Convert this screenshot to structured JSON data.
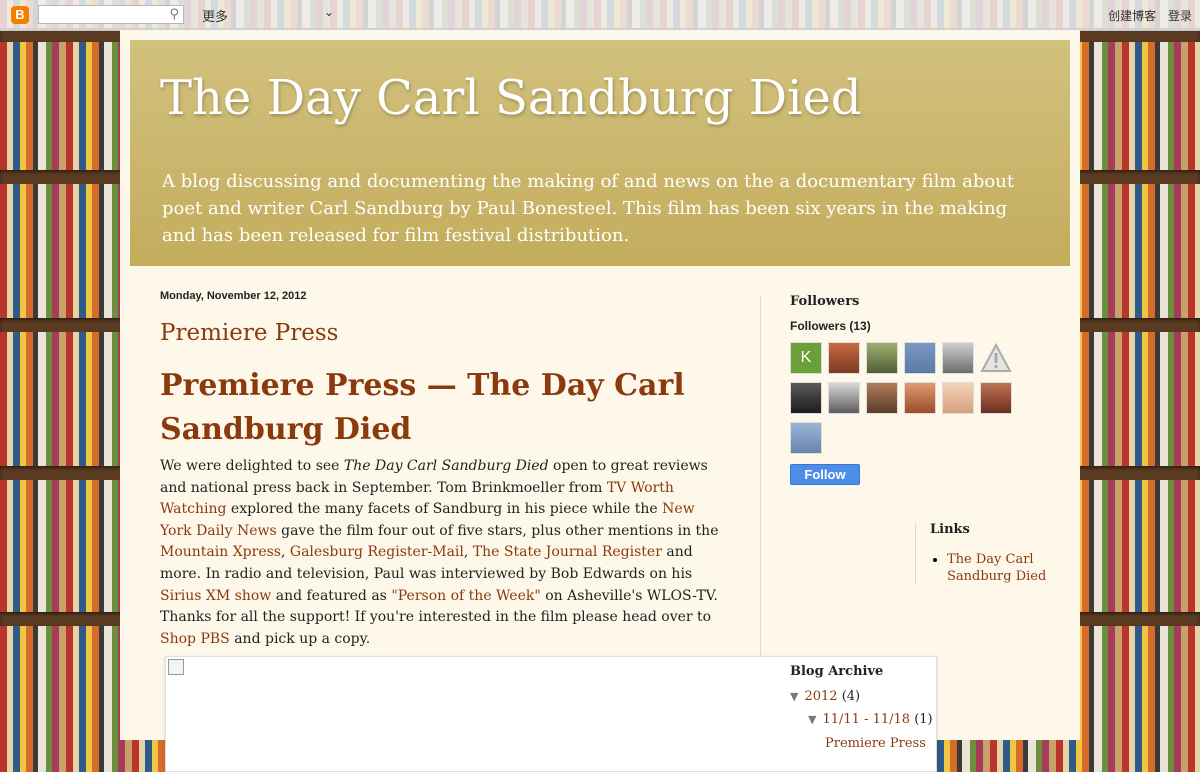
{
  "navbar": {
    "logo": "B",
    "search_placeholder": "",
    "more": "更多",
    "create_blog": "创建博客",
    "login": "登录"
  },
  "header": {
    "title": "The Day Carl Sandburg Died",
    "description": "A blog discussing and documenting the making of and news on the a documentary film about poet and writer Carl Sandburg by Paul Bonesteel. This film has been six years in the making and has been released for film festival distribution."
  },
  "post": {
    "date": "Monday, November 12, 2012",
    "title": "Premiere Press",
    "heading": "Premiere Press — The Day Carl Sandburg Died",
    "body": {
      "t1": "We were delighted to see ",
      "film": "The Day Carl Sandburg Died",
      "t2": " open to great reviews and national press back in September. Tom Brinkmoeller from ",
      "l1": "TV Worth Watching",
      "t3": " explored the many facets of Sandburg in his piece while the ",
      "l2": "New York Daily News",
      "t4": " gave the film four out of five stars, plus other mentions in the ",
      "l3": "Mountain Xpress",
      "t5": ", ",
      "l4": "Galesburg Register-Mail",
      "t6": ", ",
      "l5": "The State Journal Register",
      "t7": " and more. In radio and television, Paul was interviewed by Bob Edwards on his ",
      "l6": "Sirius XM show",
      "t8": " and featured as ",
      "l7": "\"Person of the Week\"",
      "t9": " on Asheville's WLOS-TV. Thanks for all the support! If you're interested in the film please head over to ",
      "l8": "Shop PBS",
      "t10": " and pick up a copy."
    }
  },
  "sidebar": {
    "followers_title": "Followers",
    "followers_count": "Followers (13)",
    "first_avatar_letter": "K",
    "follow_button": "Follow",
    "links_title": "Links",
    "links": [
      "The Day Carl Sandburg Died"
    ],
    "archive_title": "Blog Archive",
    "archive": {
      "year": "2012",
      "year_count": "(4)",
      "week": "11/11 - 11/18",
      "week_count": "(1)",
      "post": "Premiere Press"
    }
  },
  "colors": {
    "accent_link": "#8b3a0e",
    "header_bg": "#c9b66c",
    "page_bg": "#fdf8ea",
    "follow_button": "#4d8de8"
  }
}
